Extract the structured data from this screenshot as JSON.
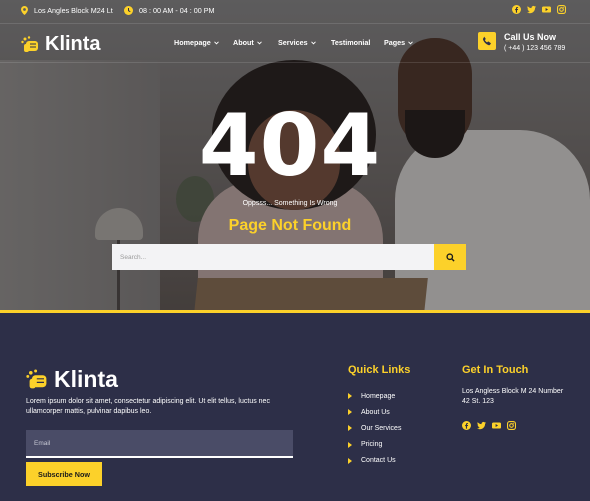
{
  "topbar": {
    "address": "Los Angles Block M24 Lt",
    "hours": "08 : 00 AM - 04 : 00 PM",
    "social_icons": [
      "facebook-icon",
      "twitter-icon",
      "youtube-icon",
      "instagram-icon"
    ]
  },
  "brand": {
    "name": "Klinta",
    "accent": "#fcd12a",
    "footer_bg": "#2d2f48"
  },
  "nav": {
    "items": [
      {
        "label": "Homepage",
        "has_dropdown": true
      },
      {
        "label": "About",
        "has_dropdown": true
      },
      {
        "label": "Services",
        "has_dropdown": true
      },
      {
        "label": "Testimonial",
        "has_dropdown": false
      },
      {
        "label": "Pages",
        "has_dropdown": true
      }
    ]
  },
  "call": {
    "title": "Call Us Now",
    "number": "( +44 ) 123 456 789"
  },
  "error": {
    "code": "404",
    "message": "Oppsss... Something Is Wrong",
    "heading": "Page Not Found"
  },
  "search": {
    "placeholder": "Search..."
  },
  "footer": {
    "about": "Lorem ipsum dolor sit amet, consectetur adipiscing elit. Ut elit tellus, luctus nec ullamcorper mattis, pulvinar dapibus leo.",
    "email_placeholder": "Email",
    "subscribe_label": "Subscribe Now",
    "quick_links": {
      "heading": "Quick Links",
      "items": [
        "Homepage",
        "About Us",
        "Our Services",
        "Pricing",
        "Contact Us"
      ]
    },
    "get_in_touch": {
      "heading": "Get In Touch",
      "address": "Los Angless Block M 24 Number 42 St. 123",
      "social_icons": [
        "facebook-icon",
        "twitter-icon",
        "youtube-icon",
        "instagram-icon"
      ]
    }
  }
}
